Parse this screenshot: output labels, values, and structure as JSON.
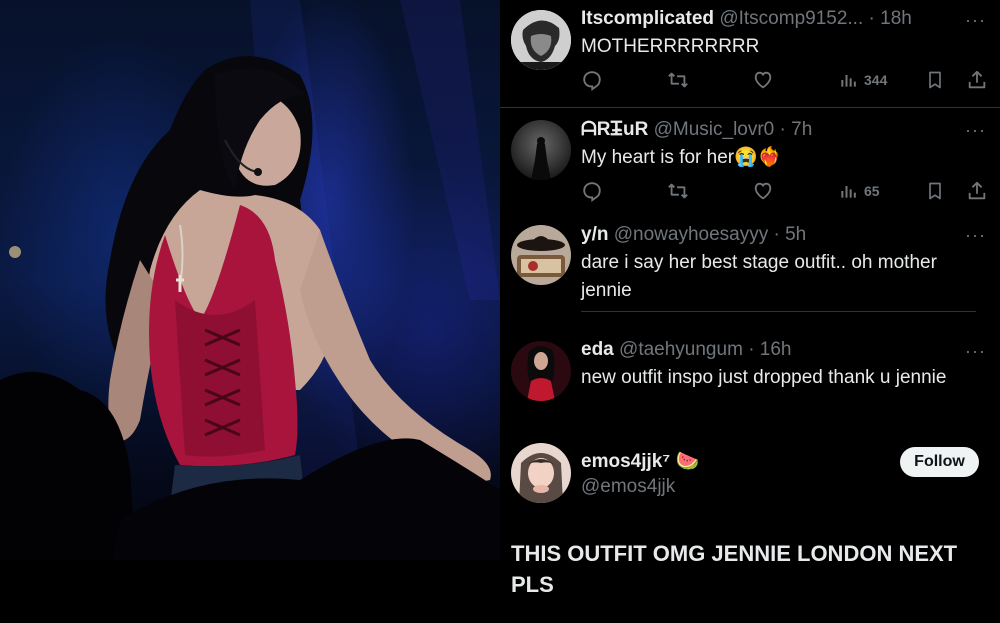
{
  "photo": {
    "description_icon": "concert-photo"
  },
  "tweets": [
    {
      "name": "Itscomplicated",
      "handle": "@Itscomp9152...",
      "dot": "·",
      "time": "18h",
      "text": "MOTHERRRRRRRR",
      "views": "344",
      "avatar_icon": "avatar-bw-portrait"
    },
    {
      "name": "ᗩRᏆ̵̶uR",
      "handle": "@Music_lovr0",
      "dot": "·",
      "time": "7h",
      "text": "My heart is for her😭❤️‍🔥",
      "views": "65",
      "avatar_icon": "avatar-dark-figure"
    },
    {
      "name": "y/n",
      "handle": "@nowayhoesayyy",
      "dot": "·",
      "time": "5h",
      "text": "dare i say her best stage outfit.. oh mother jennie",
      "avatar_icon": "avatar-cowboy-hat"
    },
    {
      "name": "eda",
      "handle": "@taehyungum",
      "dot": "·",
      "time": "16h",
      "text": "new outfit inspo just dropped thank u jennie",
      "avatar_icon": "avatar-red-dress"
    }
  ],
  "profile": {
    "name": "emos4jjk⁷ 🍉",
    "handle": "@emos4jjk",
    "follow_label": "Follow",
    "avatar_icon": "avatar-girl-portrait"
  },
  "post": {
    "text": "THIS OUTFIT OMG JENNIE LONDON NEXT PLS"
  },
  "more_label": "···",
  "colors": {
    "background": "#000000",
    "secondary_text": "#71767b",
    "divider": "#2f3336",
    "follow_bg": "#eff3f4"
  }
}
